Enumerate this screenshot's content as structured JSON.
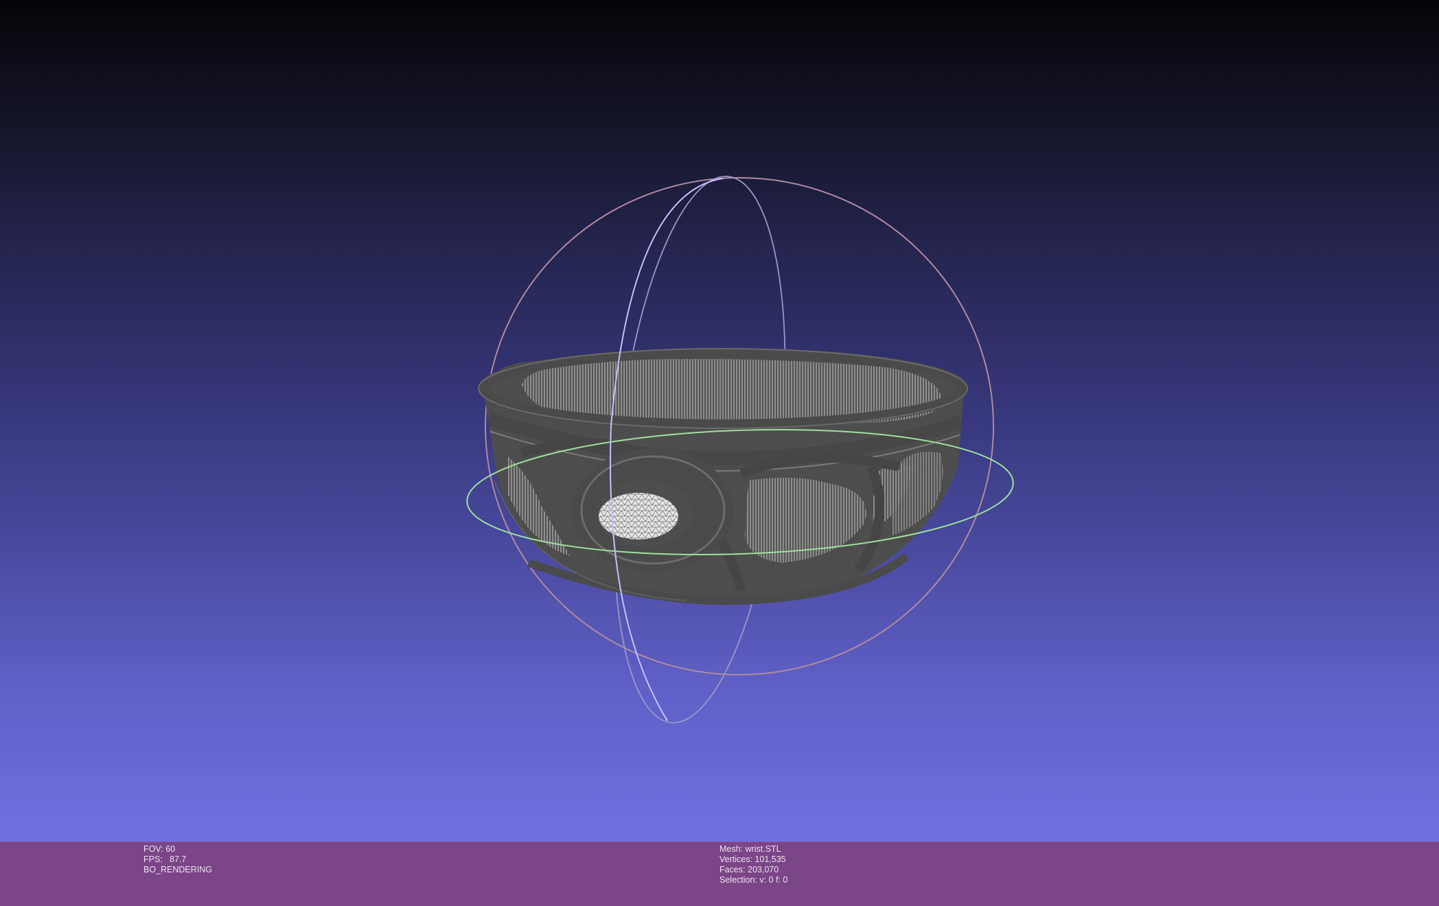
{
  "viewport": {
    "background_top": "#050508",
    "background_bottom": "#7070e2",
    "mesh_color": "#5a5a5a",
    "mesh_highlight": "#d8d8d8",
    "trackball_colors": {
      "outer": "#b58a9a",
      "vertical": "#c0c0ff",
      "horizontal": "#9fe09f"
    }
  },
  "info_bar": {
    "background": "#7c4588",
    "left": {
      "fov_label": "FOV:",
      "fov_value": "60",
      "fps_label": "FPS:",
      "fps_value": "87.7",
      "render_mode": "BO_RENDERING"
    },
    "mesh": {
      "mesh_label": "Mesh:",
      "mesh_name": "wrist.STL",
      "vertices_label": "Vertices:",
      "vertices_value": "101,535",
      "faces_label": "Faces:",
      "faces_value": "203,070",
      "selection_label": "Selection:",
      "selection_value": "v: 0 f: 0"
    }
  }
}
